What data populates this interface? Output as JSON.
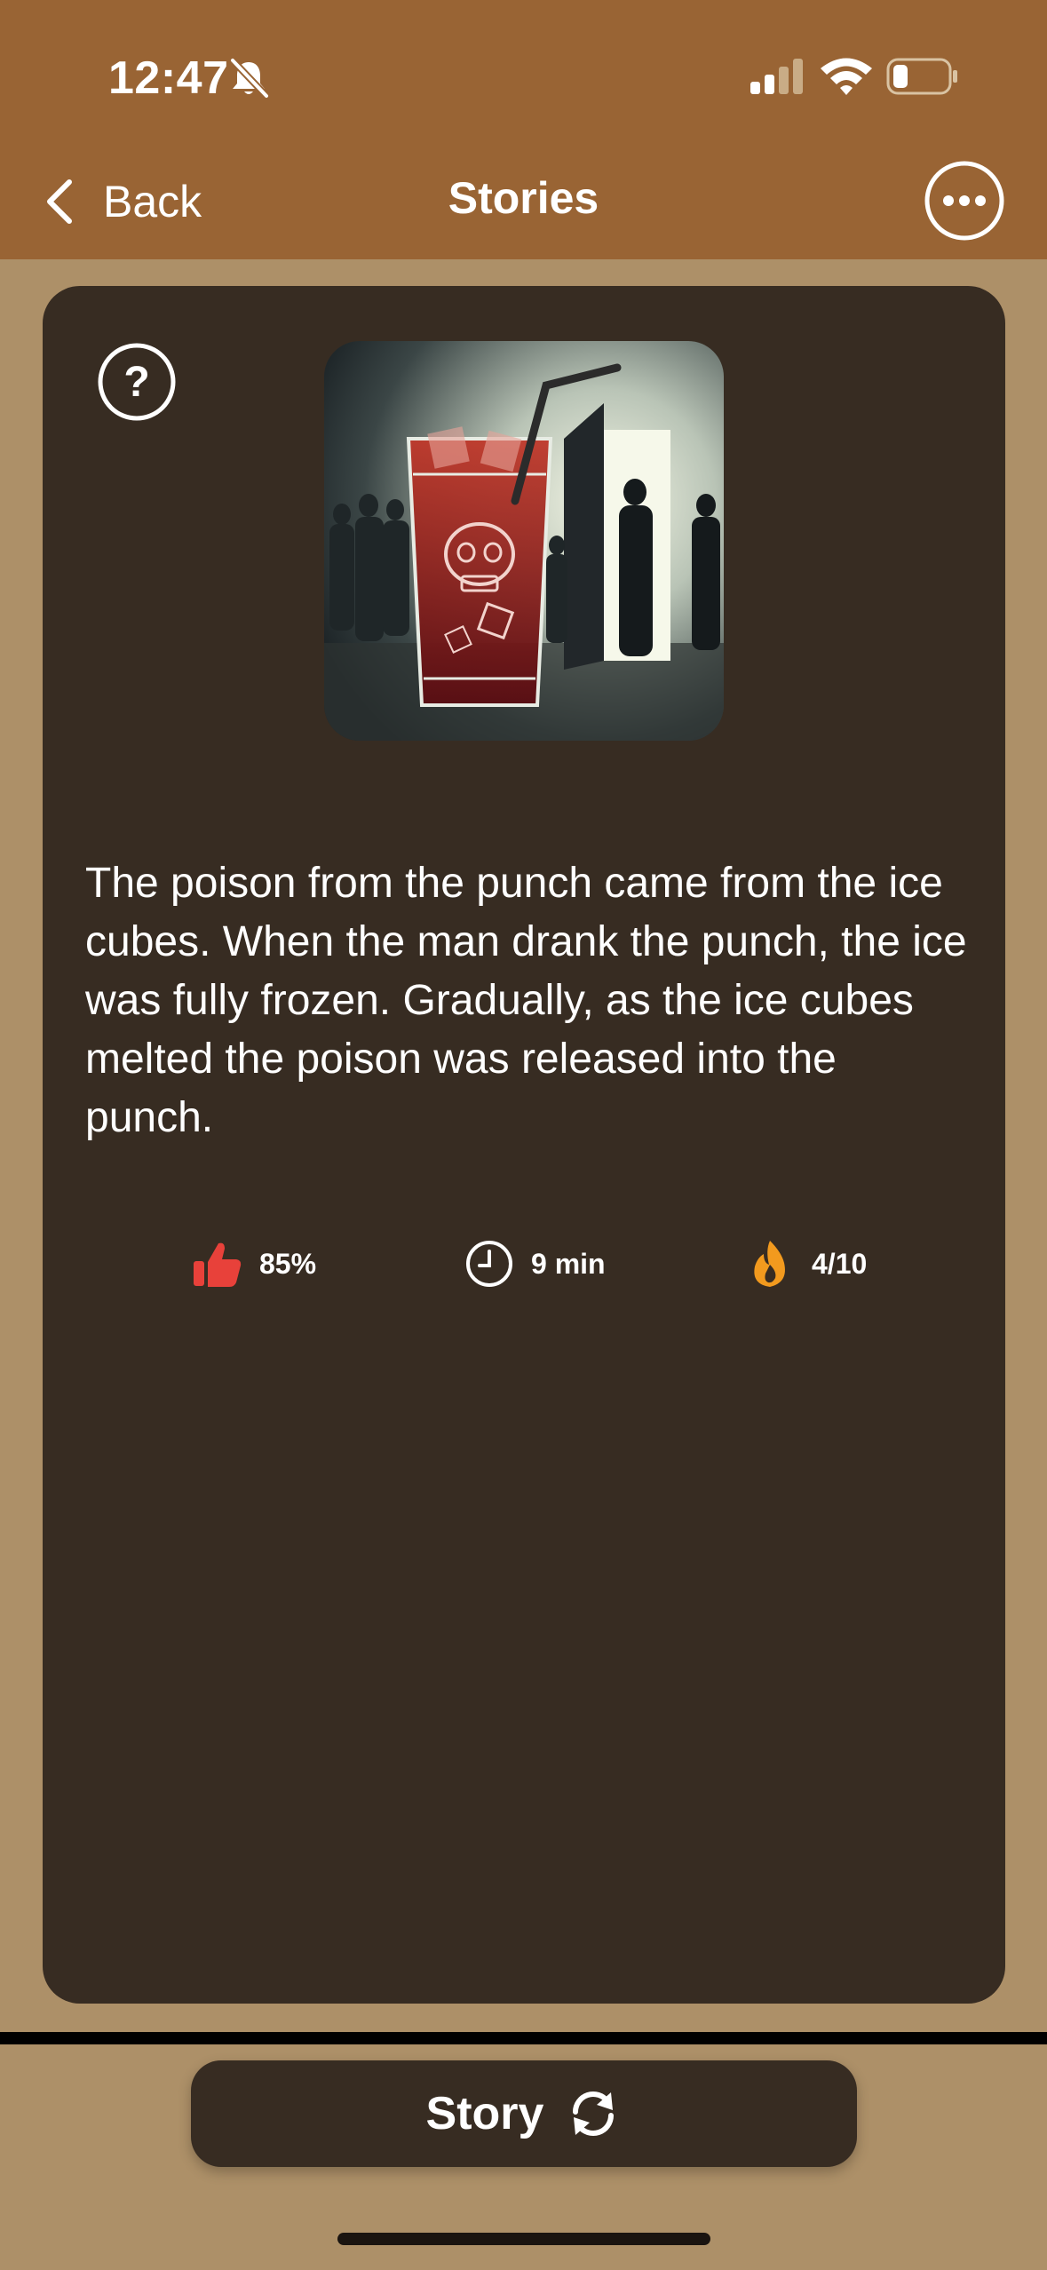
{
  "status_bar": {
    "time": "12:47",
    "bell_icon": "bell-slash-icon",
    "signal_icon": "cellular-signal-icon",
    "wifi_icon": "wifi-icon",
    "battery_icon": "battery-icon"
  },
  "nav": {
    "back_label": "Back",
    "title": "Stories",
    "more_icon": "ellipsis-circle-icon"
  },
  "card": {
    "help_icon": "question-circle-icon",
    "image_icon": "poison-punch-illustration",
    "solution_text": "The poison from the punch came from the ice cubes. When the man drank the punch, the ice was fully frozen. Gradually, as the ice cubes melted the poison was released into the punch.",
    "stats": [
      {
        "icon": "thumbs-up-icon",
        "value": "85%"
      },
      {
        "icon": "clock-icon",
        "value": "9 min"
      },
      {
        "icon": "flame-icon",
        "value": "4/10"
      }
    ]
  },
  "footer": {
    "button_label": "Story",
    "button_icon": "refresh-icon"
  },
  "colors": {
    "header": "#996434",
    "background": "#ad9068",
    "card": "#372c22",
    "thumb": "#e8413a",
    "flame": "#f29a1e"
  }
}
